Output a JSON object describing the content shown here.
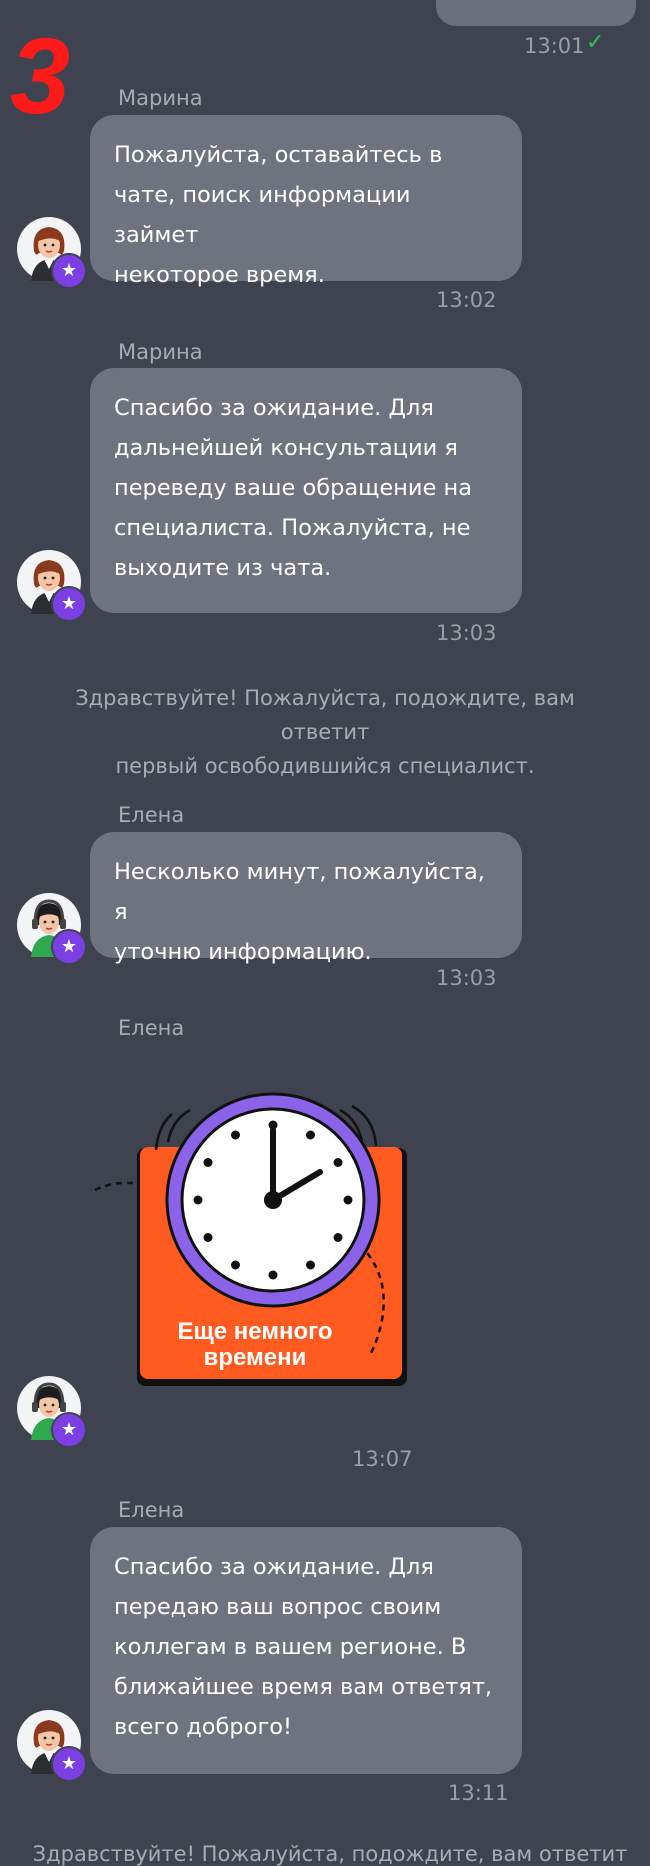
{
  "step_label": "3",
  "colors": {
    "background": "#3f4350",
    "bubble": "#6f737f",
    "accent_badge": "#7b3fe4",
    "check": "#2fbf61",
    "step_label": "#ff1a1a",
    "sticker_orange": "#ff5a1f",
    "sticker_purple": "#8a63e8"
  },
  "messages": [
    {
      "time": "13:01",
      "status_icon": "check-icon"
    },
    {
      "author": "Марина",
      "lines": [
        "Пожалуйста, оставайтесь в",
        "чате, поиск информации займет",
        "некоторое время."
      ],
      "time": "13:02"
    },
    {
      "author": "Марина",
      "lines": [
        "Спасибо за ожидание. Для",
        "дальнейшей консультации я",
        "переведу ваше обращение на",
        "специалиста. Пожалуйста, не",
        "выходите из чата."
      ],
      "time": "13:03"
    },
    {
      "system_lines": [
        "Здравствуйте! Пожалуйста, подождите, вам ответит",
        "первый освободившийся специалист."
      ]
    },
    {
      "author": "Елена",
      "lines": [
        "Несколько минут, пожалуйста, я",
        "уточню информацию."
      ],
      "time": "13:03"
    },
    {
      "author": "Елена",
      "sticker_caption": [
        "Еще немного",
        "времени"
      ],
      "time": "13:07"
    },
    {
      "author": "Елена",
      "lines": [
        "Спасибо за ожидание. Для",
        "передаю ваш вопрос своим",
        "коллегам в вашем регионе. В",
        "ближайшее время вам ответят,",
        "всего доброго!"
      ],
      "time": "13:11"
    }
  ],
  "partial_system_text": "Здравствуйте! Пожалуйста, подождите, вам ответит"
}
